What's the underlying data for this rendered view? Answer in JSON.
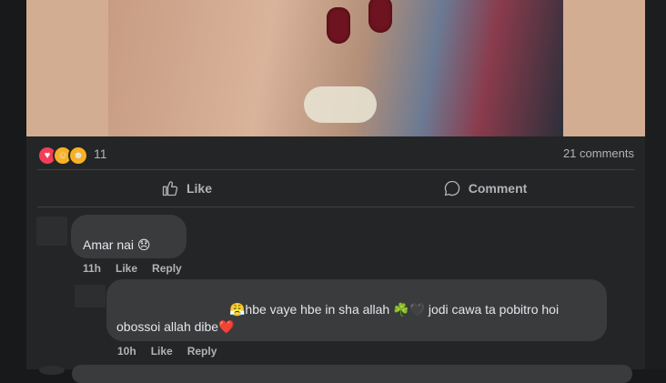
{
  "post": {
    "reaction_count": "11",
    "comments_count": "21 comments",
    "reactions": [
      "love",
      "care",
      "haha"
    ]
  },
  "actions": {
    "like_label": "Like",
    "comment_label": "Comment"
  },
  "comments": [
    {
      "text": "Amar nai 😞",
      "time": "11h",
      "like": "Like",
      "reply": "Reply"
    },
    {
      "line1": "😤hbe vaye hbe in sha allah ☘️🖤 jodi cawa ta pobitro hoi",
      "line2": "obossoi allah dibe❤️",
      "time": "10h",
      "like": "Like",
      "reply": "Reply"
    }
  ],
  "colors": {
    "background": "#242526",
    "bubble": "#3a3b3c",
    "muted_text": "#b0b3b8"
  },
  "icons": {
    "like": "thumbs-up-icon",
    "comment": "speech-bubble-icon"
  }
}
